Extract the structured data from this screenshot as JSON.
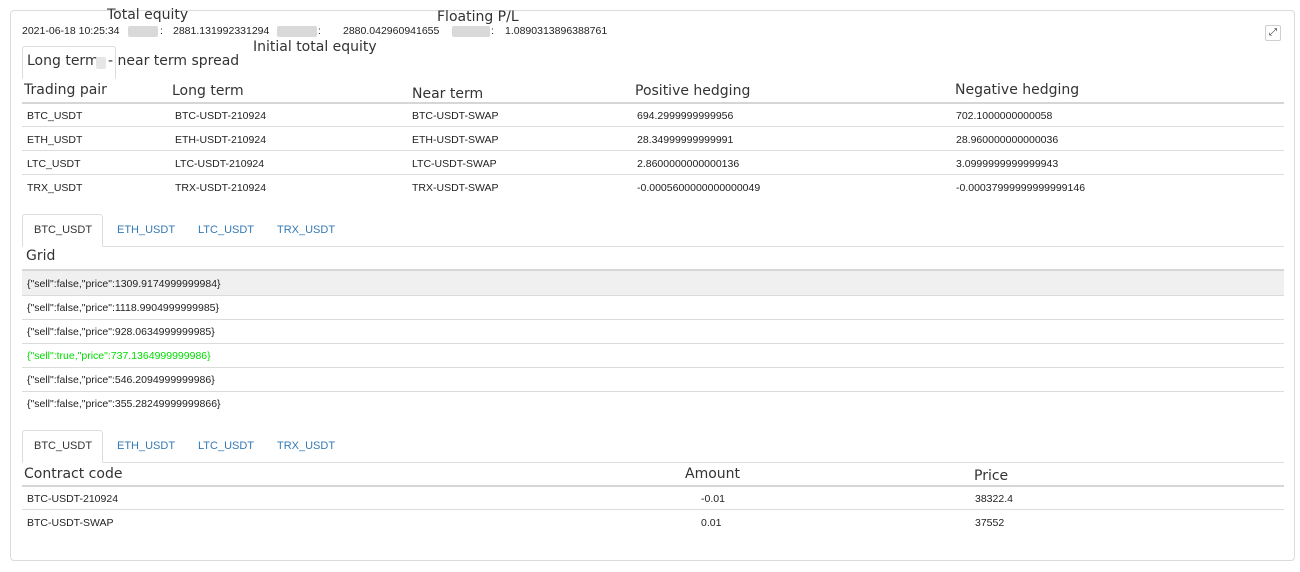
{
  "status": {
    "timestamp": "2021-06-18 10:25:34",
    "total_equity_label": "Total equity",
    "total_equity_value": "2881.131992331294",
    "initial_equity_label": "Initial total equity",
    "initial_equity_value": "2880.042960941655",
    "floating_pl_label": "Floating P/L",
    "floating_pl_value": "1.0890313896388761",
    "colon": ":"
  },
  "spread_table": {
    "tab_label_a": "Long term",
    "tab_label_b": "- near term spread",
    "columns": [
      "Trading pair",
      "Long term",
      "Near term",
      "Positive hedging",
      "Negative hedging"
    ],
    "rows": [
      [
        "BTC_USDT",
        "BTC-USDT-210924",
        "BTC-USDT-SWAP",
        "694.2999999999956",
        "702.1000000000058"
      ],
      [
        "ETH_USDT",
        "ETH-USDT-210924",
        "ETH-USDT-SWAP",
        "28.34999999999991",
        "28.960000000000036"
      ],
      [
        "LTC_USDT",
        "LTC-USDT-210924",
        "LTC-USDT-SWAP",
        "2.8600000000000136",
        "3.0999999999999943"
      ],
      [
        "TRX_USDT",
        "TRX-USDT-210924",
        "TRX-USDT-SWAP",
        "-0.0005600000000000049",
        "-0.00037999999999999146"
      ]
    ]
  },
  "grid_section": {
    "tabs": [
      "BTC_USDT",
      "ETH_USDT",
      "LTC_USDT",
      "TRX_USDT"
    ],
    "active_tab": "BTC_USDT",
    "header": "Grid",
    "rows": [
      "{\"sell\":false,\"price\":1309.9174999999984}",
      "{\"sell\":false,\"price\":1118.9904999999985}",
      "{\"sell\":false,\"price\":928.0634999999985}",
      "{\"sell\":true,\"price\":737.1364999999986}",
      "{\"sell\":false,\"price\":546.2094999999986}",
      "{\"sell\":false,\"price\":355.28249999999866}"
    ],
    "highlight_color": "#00dd00"
  },
  "positions_section": {
    "tabs": [
      "BTC_USDT",
      "ETH_USDT",
      "LTC_USDT",
      "TRX_USDT"
    ],
    "active_tab": "BTC_USDT",
    "columns": [
      "Contract code",
      "Amount",
      "Price"
    ],
    "rows": [
      [
        "BTC-USDT-210924",
        "-0.01",
        "38322.4"
      ],
      [
        "BTC-USDT-SWAP",
        "0.01",
        "37552"
      ]
    ]
  },
  "icons": {
    "expand": "expand-icon"
  }
}
